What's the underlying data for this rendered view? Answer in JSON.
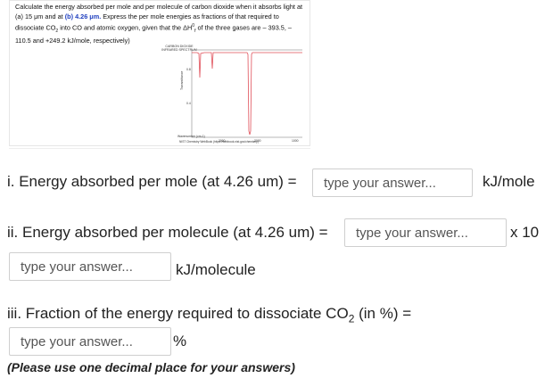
{
  "question": {
    "text_before": "Calculate the energy absorbed per mole and per molecule of carbon dioxide when it absorbs light at (a) 15 μm and at ",
    "text_highlight": "(b) 4.26 μm.",
    "text_after": " Express the per mole energies as fractions of that required to dissociate CO",
    "text_after2": " into CO and atomic oxygen, given that the ΔH",
    "text_after3": " of the three gases are – 393.5, – 110.5 and +249.2 kJ/mole, respectively)",
    "sub_2": "2",
    "delta_sup": "0",
    "delta_sub": "f"
  },
  "spectrum": {
    "title_line1": "CARBON DIOXIDE",
    "title_line2": "INFRARED SPECTRUM",
    "ylabel": "Transmittance",
    "xlabel": "Wavenumber (cm-1)",
    "credit": "NIST Chemistry WebBook (https://webbook.nist.gov/chemistry)",
    "x_ticks": [
      "3000",
      "2000",
      "1000"
    ],
    "y_ticks": [
      "0.8",
      "0.4"
    ],
    "line_color": "#e0505a"
  },
  "q1": {
    "label": "i. Energy absorbed per mole (at 4.26 um) =",
    "placeholder": "type your answer...",
    "unit": "kJ/mole"
  },
  "q2": {
    "label": "ii. Energy absorbed per molecule (at 4.26 um) =",
    "placeholder": "type your answer...",
    "times": "x 10",
    "exp_placeholder": "type your answer...",
    "unit": "kJ/molecule"
  },
  "q3": {
    "label_before": "iii. Fraction of the energy required to dissociate CO",
    "sub": "2",
    "label_after": " (in %)  =",
    "placeholder": "type your answer...",
    "unit": "%"
  },
  "note": "(Please use one decimal place for your answers)"
}
